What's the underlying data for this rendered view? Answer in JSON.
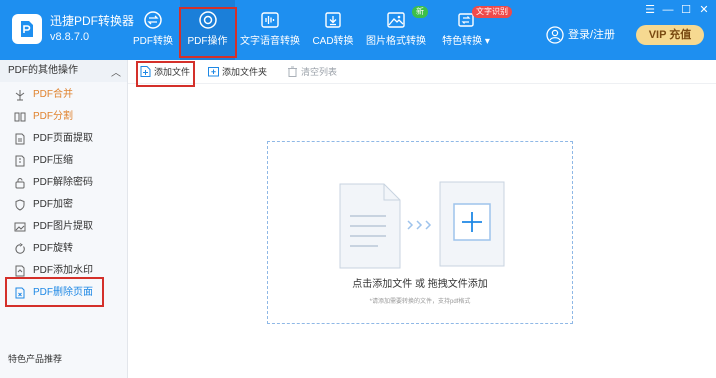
{
  "app": {
    "name": "迅捷PDF转换器",
    "version": "v8.8.7.0"
  },
  "nav": {
    "tabs": [
      {
        "label": "PDF转换",
        "icon": "swap-circle-icon"
      },
      {
        "label": "PDF操作",
        "icon": "disc-icon"
      },
      {
        "label": "文字语音转换",
        "icon": "audio-wave-icon"
      },
      {
        "label": "CAD转换",
        "icon": "cad-download-icon"
      },
      {
        "label": "图片格式转换",
        "icon": "image-icon"
      },
      {
        "label": "特色转换",
        "icon": "convert-icon"
      }
    ],
    "badge_new": "新",
    "badge_ocr": "文字识别"
  },
  "account": {
    "login_label": "登录/注册",
    "vip_label": "VIP 充值"
  },
  "sidebar": {
    "section_title": "PDF的其他操作",
    "items": [
      {
        "label": "PDF合并",
        "icon": "merge-icon"
      },
      {
        "label": "PDF分割",
        "icon": "split-icon"
      },
      {
        "label": "PDF页面提取",
        "icon": "page-extract-icon"
      },
      {
        "label": "PDF压缩",
        "icon": "compress-icon"
      },
      {
        "label": "PDF解除密码",
        "icon": "unlock-icon"
      },
      {
        "label": "PDF加密",
        "icon": "shield-icon"
      },
      {
        "label": "PDF图片提取",
        "icon": "image-extract-icon"
      },
      {
        "label": "PDF旋转",
        "icon": "rotate-icon"
      },
      {
        "label": "PDF添加水印",
        "icon": "watermark-icon"
      },
      {
        "label": "PDF删除页面",
        "icon": "delete-page-icon"
      }
    ],
    "footer_title": "特色产品推荐"
  },
  "toolbar": {
    "add_file": "添加文件",
    "add_folder": "添加文件夹",
    "clear_list": "清空列表"
  },
  "dropzone": {
    "title": "点击添加文件 或 拖拽文件添加",
    "subtitle": "*请添加需要转换的文件，支持pdf格式"
  },
  "colors": {
    "header_bg": "#1e8ff0",
    "accent_orange": "#e0832f",
    "accent_blue": "#1e88e5",
    "highlight_red": "#d4302a",
    "vip_gold": "#f6d991"
  }
}
